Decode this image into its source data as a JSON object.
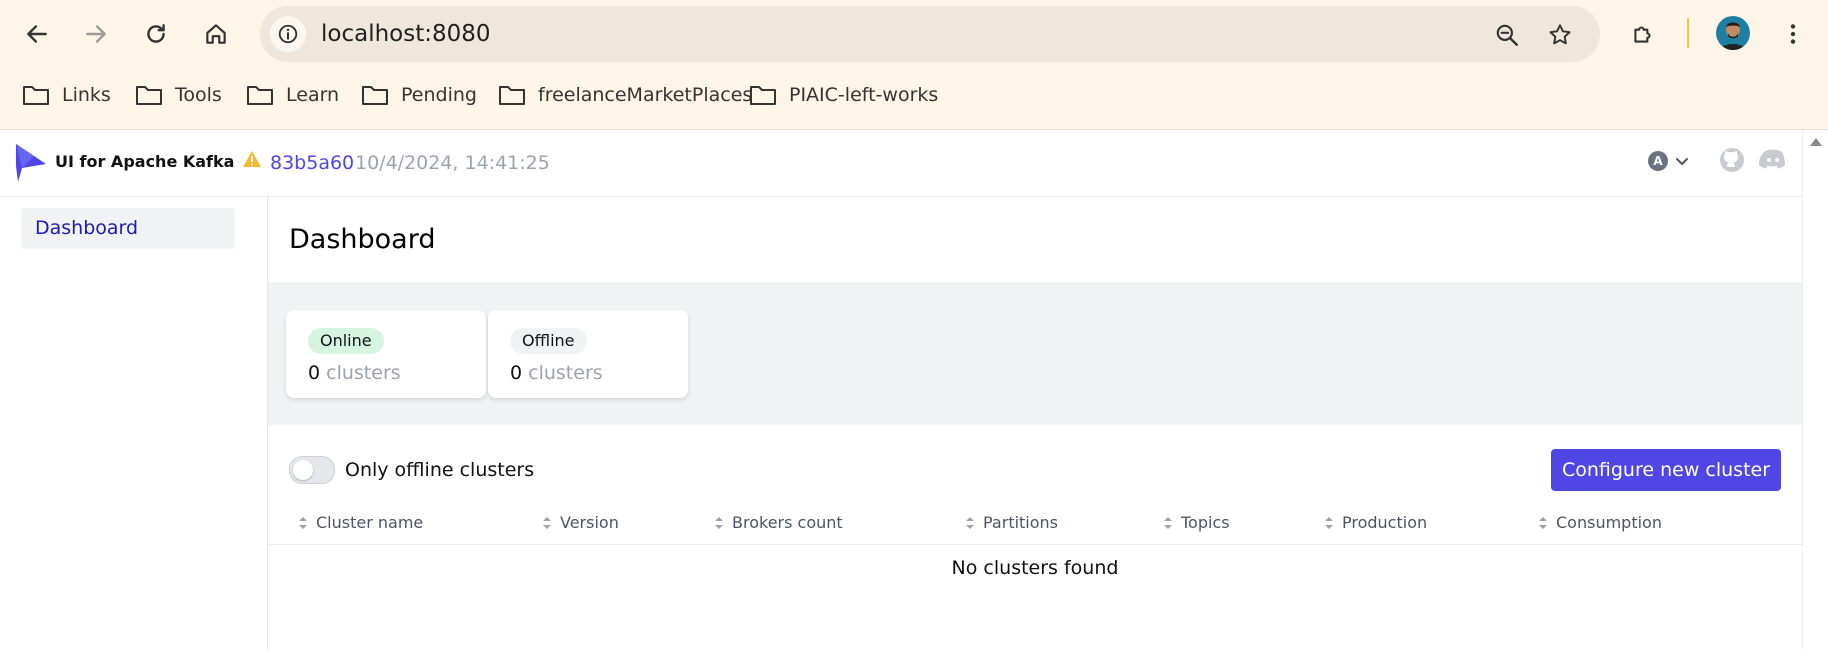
{
  "browser": {
    "url": "localhost:8080",
    "bookmarks": [
      {
        "label": "Links"
      },
      {
        "label": "Tools"
      },
      {
        "label": "Learn"
      },
      {
        "label": "Pending"
      },
      {
        "label": "freelanceMarketPlaces"
      },
      {
        "label": "PIAIC-left-works"
      }
    ]
  },
  "header": {
    "title": "UI for Apache Kafka",
    "commit": "83b5a60",
    "build_date": "10/4/2024, 14:41:25",
    "avatar_letter": "A"
  },
  "sidebar": {
    "items": [
      {
        "label": "Dashboard"
      }
    ]
  },
  "dashboard": {
    "title": "Dashboard",
    "stats": [
      {
        "label": "Online",
        "count": "0",
        "unit": "clusters"
      },
      {
        "label": "Offline",
        "count": "0",
        "unit": "clusters"
      }
    ],
    "toggle_label": "Only offline clusters",
    "toggle_on": false,
    "configure_button": "Configure new cluster",
    "columns": [
      "Cluster name",
      "Version",
      "Brokers count",
      "Partitions",
      "Topics",
      "Production",
      "Consumption"
    ],
    "empty_message": "No clusters found"
  },
  "colors": {
    "accent": "#4f46e5",
    "online_tag": "#d6f5e0",
    "chrome_bg": "#fdf5e8"
  }
}
